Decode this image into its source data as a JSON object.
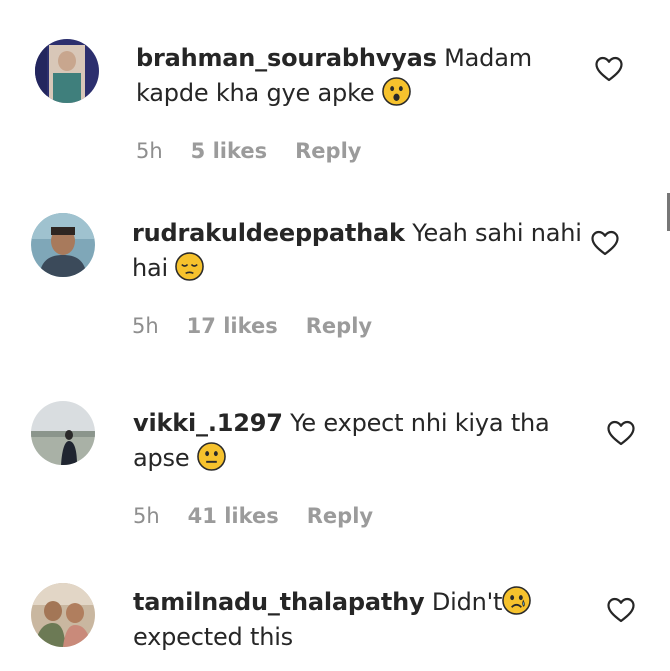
{
  "comments": [
    {
      "username": "brahman_sourabhvyas",
      "text": " Madam kapde kha gye apke ",
      "emoji": "astonished-face-icon",
      "time": "5h",
      "likes": "5 likes",
      "reply_label": "Reply",
      "avatar": "avatar-1-image"
    },
    {
      "username": "rudrakuldeeppathak",
      "text": " Yeah sahi nahi hai ",
      "emoji": "pensive-face-icon",
      "time": "5h",
      "likes": "17 likes",
      "reply_label": "Reply",
      "avatar": "avatar-2-image"
    },
    {
      "username": "vikki_.1297",
      "text": " Ye expect nhi kiya tha apse ",
      "emoji": "neutral-face-icon",
      "time": "5h",
      "likes": "41 likes",
      "reply_label": "Reply",
      "avatar": "avatar-3-image"
    },
    {
      "username": "tamilnadu_thalapathy",
      "text": " Didn't",
      "emoji": "sad-tear-face-icon",
      "text2": " expected this",
      "avatar": "avatar-4-image"
    }
  ],
  "icons": {
    "like": "heart-outline-icon"
  },
  "colors": {
    "meta": "#8e8e8e",
    "text": "#262626",
    "emoji": "#f4c430"
  }
}
